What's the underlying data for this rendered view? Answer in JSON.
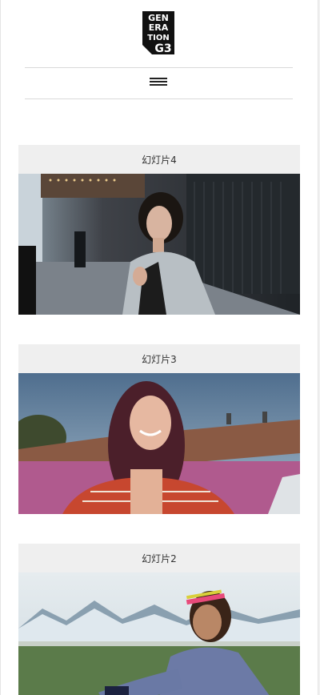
{
  "brand": {
    "logo_lines": [
      "GEN",
      "ERA",
      "TION",
      "G3"
    ]
  },
  "nav": {
    "menu_icon": "hamburger-menu-icon"
  },
  "slides": [
    {
      "title": "幻灯片4",
      "image": "woman-on-city-street-photo"
    },
    {
      "title": "幻灯片3",
      "image": "smiling-woman-rooftop-photo"
    },
    {
      "title": "幻灯片2",
      "image": "woman-athlete-mountain-field-photo"
    }
  ]
}
